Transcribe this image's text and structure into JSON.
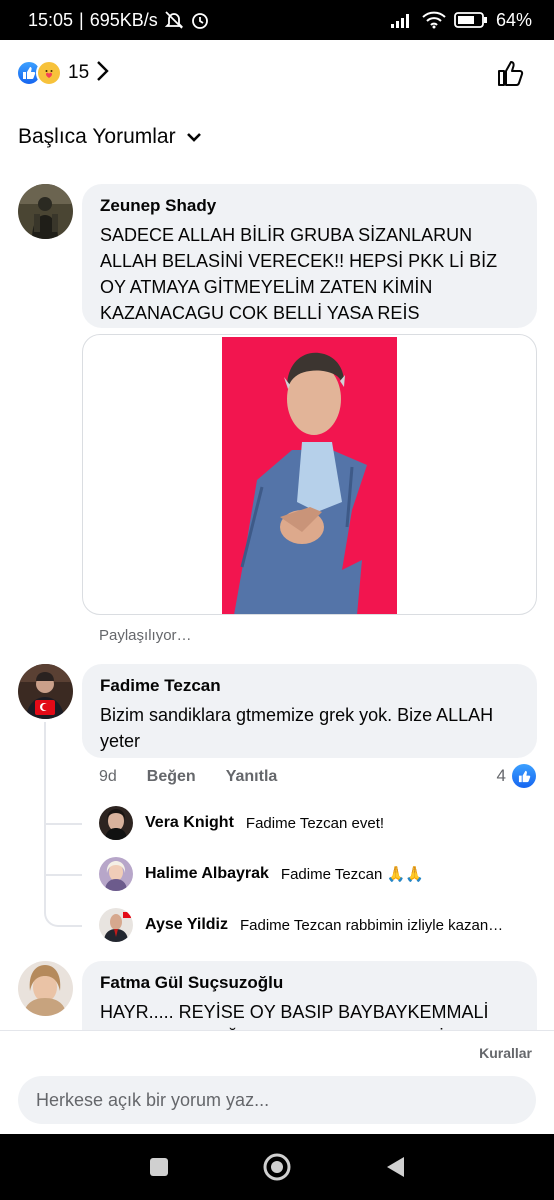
{
  "status": {
    "time": "15:05",
    "speed": "695KB/s",
    "battery": "64"
  },
  "reactions": {
    "count": "15",
    "icons": [
      "like-icon",
      "care-icon"
    ]
  },
  "sort": {
    "label": "Başlıca Yorumlar"
  },
  "comments": [
    {
      "name": "Zeunep Shady",
      "text": "SADECE ALLAH BİLİR GRUBA SİZANLARUN ALLAH BELASİNİ VERECEK!! HEPSİ PKK Lİ BİZ OY ATMAYA GİTMEYELİM ZATEN KİMİN KAZANACAGU COK BELLİ YASA REİS",
      "status": "Paylaşılıyor…"
    },
    {
      "name": "Fadime Tezcan",
      "text": "Bizim sandiklara gtmemize grek yok. Bize ALLAH yeter",
      "time": "9d",
      "like_label": "Beğen",
      "reply_label": "Yanıtla",
      "likes": "4"
    },
    {
      "name": "Fatma Gül Suçsuzoğlu",
      "text": "HAYR..... REYİSE OY BASIP BAYBAYKEMMALİ YORTACAZ KAĞUTTAN ... SADECE REYİS"
    }
  ],
  "replies": [
    {
      "name": "Vera Knight",
      "text": "Fadime Tezcan evet!"
    },
    {
      "name": "Halime Albayrak",
      "text": "Fadime Tezcan 🙏🙏"
    },
    {
      "name": "Ayse Yildiz",
      "text": "Fadime Tezcan rabbimin izliyle kazan…"
    }
  ],
  "footer": {
    "rules_label": "Kurallar",
    "composer_placeholder": "Herkese açık bir yorum yaz..."
  },
  "colors": {
    "accent": "#1877f2",
    "bubble": "#f0f2f5",
    "muted": "#65676b",
    "shared_bg": "#f2154f"
  }
}
